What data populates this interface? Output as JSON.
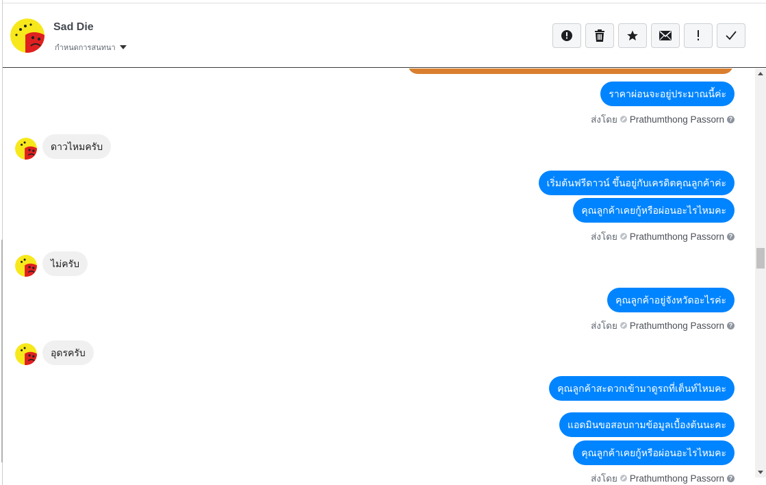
{
  "contact": {
    "name": "Sad Die",
    "conversation_label": "กำหนดการสนทนา"
  },
  "toolbar": [
    {
      "icon": "alert-circle-icon"
    },
    {
      "icon": "trash-icon"
    },
    {
      "icon": "star-icon"
    },
    {
      "icon": "envelope-icon"
    },
    {
      "icon": "exclamation-icon"
    },
    {
      "icon": "checkmark-icon"
    }
  ],
  "messages": {
    "m1": "ราคาผ่อนจะอยู่ประมาณนี้ค่ะ",
    "m2": "ดาวไหมครับ",
    "m3": "เริ่มต้นฟรีดาวน์ ขึ้นอยู่กับเครดิตคุณลูกค้าค่ะ",
    "m4": "คุณลูกค้าเคยกู้หรือผ่อนอะไรไหมคะ",
    "m5": "ไม่ครับ",
    "m6": "คุณลูกค้าอยู่จังหวัดอะไรค่ะ",
    "m7": "อุดรครับ",
    "m8": "คุณลูกค้าสะดวกเข้ามาดูรถที่เต็นท์ไหมคะ",
    "m9": "แอดมินขอสอบถามข้อมูลเบื้องต้นนะคะ",
    "m10": "คุณลูกค้าเคยกู้หรือผ่อนอะไรไหมคะ"
  },
  "sent_by": {
    "label": "ส่งโดย",
    "agent": "Prathumthong Passorn",
    "help": "?"
  },
  "colors": {
    "outgoing_bubble": "#0084ff",
    "incoming_bubble": "#f1f0f0",
    "orange_card": "#d97f2f"
  }
}
